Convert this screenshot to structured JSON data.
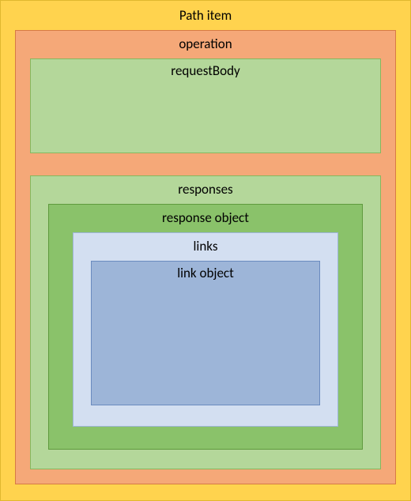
{
  "pathItem": {
    "label": "Path item"
  },
  "operation": {
    "label": "operation"
  },
  "requestBody": {
    "label": "requestBody"
  },
  "responses": {
    "label": "responses"
  },
  "responseObject": {
    "label": "response object"
  },
  "links": {
    "label": "links"
  },
  "linkObject": {
    "label": "link object"
  }
}
